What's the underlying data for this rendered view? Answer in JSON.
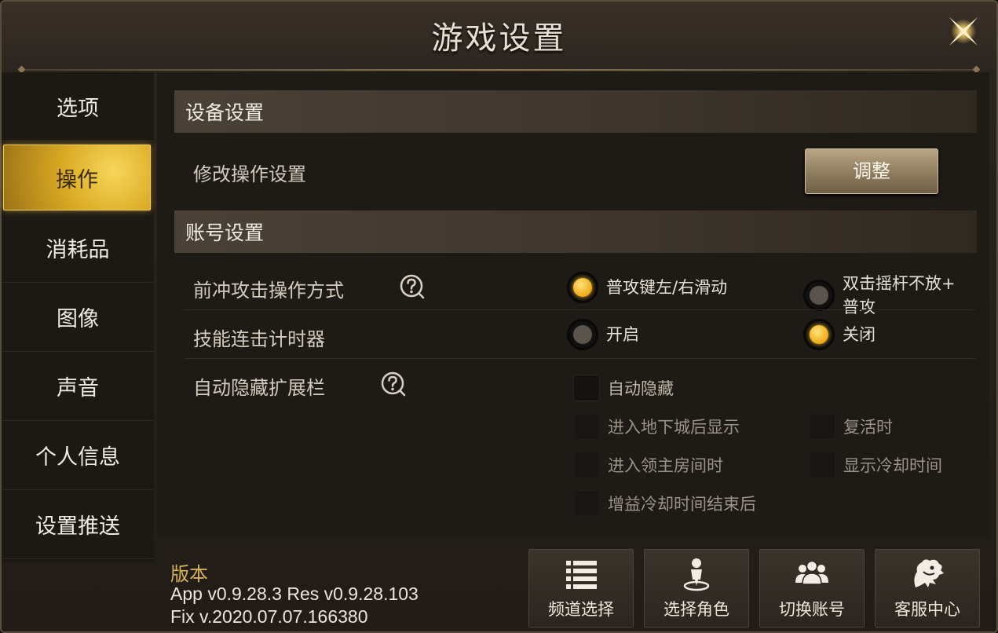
{
  "window": {
    "title": "游戏设置"
  },
  "sidebar": {
    "items": [
      {
        "label": "选项"
      },
      {
        "label": "操作",
        "active": true
      },
      {
        "label": "消耗品"
      },
      {
        "label": "图像"
      },
      {
        "label": "声音"
      },
      {
        "label": "个人信息"
      },
      {
        "label": "设置推送"
      }
    ]
  },
  "sections": {
    "device": {
      "title": "设备设置",
      "modify_label": "修改操作设置",
      "adjust_button": "调整"
    },
    "account": {
      "title": "账号设置",
      "dash_attack": {
        "label": "前冲攻击操作方式",
        "options": [
          "普攻键左/右滑动",
          "双击摇杆不放+",
          "普攻"
        ],
        "selected": "普攻键左/右滑动"
      },
      "combo_timer": {
        "label": "技能连击计时器",
        "options": [
          "开启",
          "关闭"
        ],
        "selected": "关闭"
      },
      "auto_hide": {
        "label": "自动隐藏扩展栏",
        "options": {
          "auto_hide": "自动隐藏",
          "enter_dungeon": "进入地下城后显示",
          "revive": "复活时",
          "enter_boss_room": "进入领主房间时",
          "show_cooldown": "显示冷却时间",
          "buff_cooldown_end": "增益冷却时间结束后"
        }
      }
    }
  },
  "footer": {
    "version_title": "版本",
    "version_app": "App v0.9.28.3 Res v0.9.28.103",
    "version_fix": "Fix v.2020.07.07.166380",
    "buttons": {
      "channel": "频道选择",
      "character": "选择角色",
      "account": "切换账号",
      "support": "客服中心"
    }
  },
  "colors": {
    "accent_gold": "#f0aa16",
    "active_tab": "#d9a923",
    "version_title": "#d8b25a"
  },
  "icons": {
    "close": "close-icon",
    "help": "help-icon",
    "channel": "list-icon",
    "character": "person-pin-icon",
    "account": "group-icon",
    "support": "dragon-icon"
  }
}
